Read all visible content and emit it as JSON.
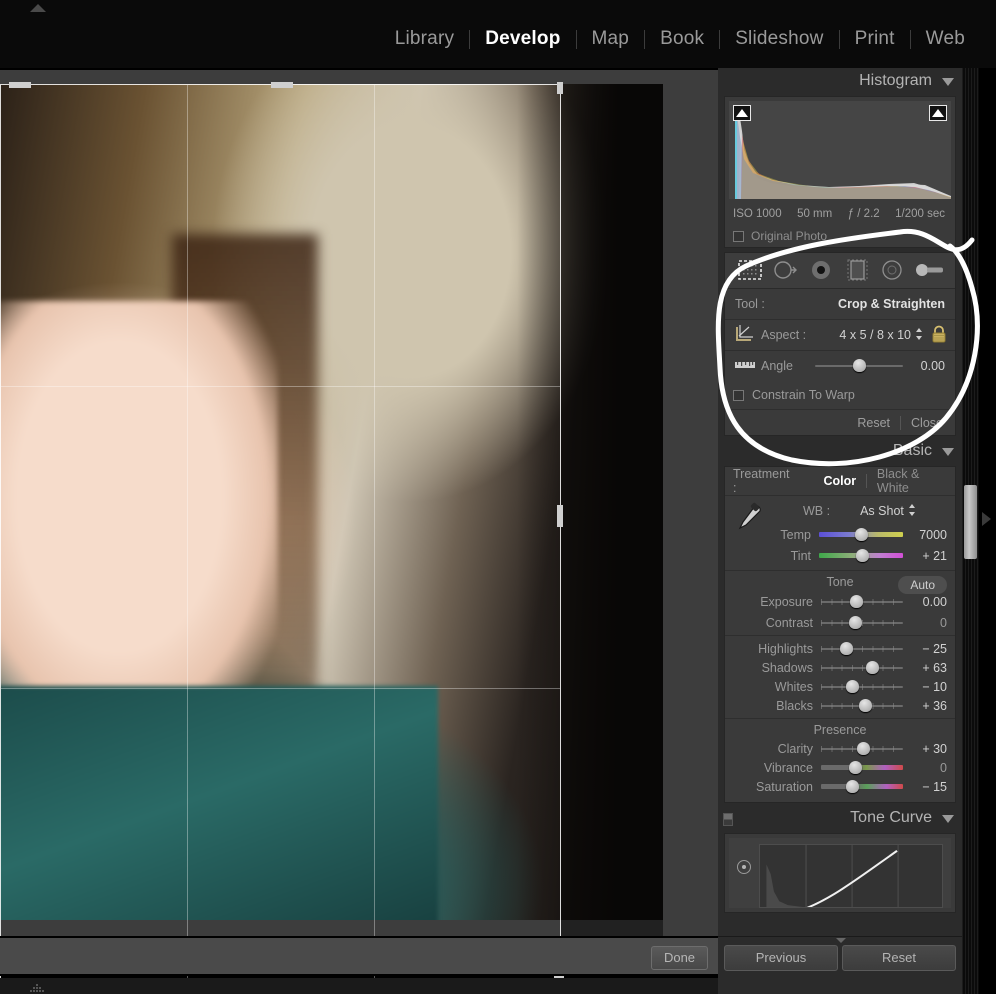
{
  "modules": [
    {
      "label": "Library",
      "active": false
    },
    {
      "label": "Develop",
      "active": true
    },
    {
      "label": "Map",
      "active": false
    },
    {
      "label": "Book",
      "active": false
    },
    {
      "label": "Slideshow",
      "active": false
    },
    {
      "label": "Print",
      "active": false
    },
    {
      "label": "Web",
      "active": false
    }
  ],
  "histogram": {
    "title": "Histogram",
    "exif": {
      "iso": "ISO 1000",
      "focal": "50 mm",
      "aperture": "ƒ / 2.2",
      "shutter": "1/200 sec"
    },
    "original_photo_label": "Original Photo"
  },
  "crop_panel": {
    "tools": [
      "crop-overlay-icon",
      "spot-removal-icon",
      "red-eye-icon",
      "graduated-filter-icon",
      "radial-filter-icon",
      "adjustment-brush-icon"
    ],
    "tool_label": "Tool :",
    "tool_value": "Crop & Straighten",
    "aspect_label": "Aspect :",
    "aspect_value": "4 x 5 / 8 x 10",
    "lock_state": "locked",
    "angle_label": "Angle",
    "angle_value": "0.00",
    "angle_pos": 50,
    "constrain_label": "Constrain To Warp",
    "constrain_checked": false,
    "reset_label": "Reset",
    "close_label": "Close"
  },
  "basic": {
    "title": "Basic",
    "treatment_label": "Treatment :",
    "treatment_color": "Color",
    "treatment_bw": "Black & White",
    "wb_label": "WB :",
    "wb_value": "As Shot",
    "sliders": [
      {
        "name": "Temp",
        "value": "7000",
        "pos": 50,
        "track": "grad-temp"
      },
      {
        "name": "Tint",
        "value": "+ 21",
        "pos": 52,
        "track": "grad-tint"
      }
    ],
    "tone_title": "Tone",
    "auto_label": "Auto",
    "tone_sliders": [
      {
        "name": "Exposure",
        "value": "0.00",
        "pos": 43,
        "track": "plain"
      },
      {
        "name": "Contrast",
        "value": "0",
        "pos": 42,
        "track": "plain"
      }
    ],
    "tone_sliders2": [
      {
        "name": "Highlights",
        "value": "− 25",
        "pos": 31,
        "track": "plain"
      },
      {
        "name": "Shadows",
        "value": "+ 63",
        "pos": 63,
        "track": "plain"
      },
      {
        "name": "Whites",
        "value": "− 10",
        "pos": 38,
        "track": "plain"
      },
      {
        "name": "Blacks",
        "value": "+ 36",
        "pos": 54,
        "track": "plain"
      }
    ],
    "presence_title": "Presence",
    "presence_sliders": [
      {
        "name": "Clarity",
        "value": "+ 30",
        "pos": 52,
        "track": "plain"
      },
      {
        "name": "Vibrance",
        "value": "0",
        "pos": 42,
        "track": "grad-vib"
      },
      {
        "name": "Saturation",
        "value": "− 15",
        "pos": 38,
        "track": "grad-sat"
      }
    ]
  },
  "tone_curve": {
    "title": "Tone Curve"
  },
  "toolbar": {
    "done_label": "Done"
  },
  "bottom": {
    "previous_label": "Previous",
    "reset_label": "Reset"
  }
}
